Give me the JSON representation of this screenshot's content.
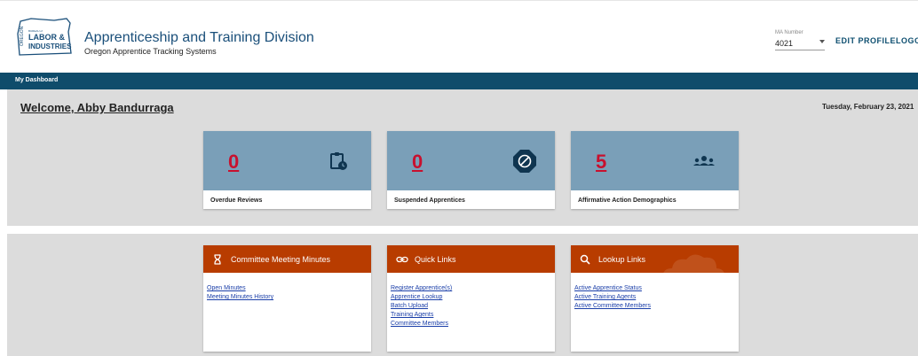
{
  "header": {
    "logo_text": "OREGON BUREAU of LABOR & INDUSTRIES",
    "title": "Apprenticeship and Training Division",
    "subtitle": "Oregon Apprentice Tracking Systems",
    "ma_number_label": "MA Number",
    "ma_number_value": "4021",
    "edit_profile": "EDIT PROFILE",
    "logout": "LOGOU"
  },
  "nav": {
    "items": [
      {
        "label": "My Dashboard"
      }
    ]
  },
  "welcome": {
    "text": "Welcome, Abby Bandurraga",
    "date": "Tuesday, February 23, 2021"
  },
  "stats": [
    {
      "value": "0",
      "label": "Overdue Reviews",
      "icon": "clipboard-clock-icon"
    },
    {
      "value": "0",
      "label": "Suspended Apprentices",
      "icon": "block-icon"
    },
    {
      "value": "5",
      "label": "Affirmative Action Demographics",
      "icon": "group-icon"
    }
  ],
  "panels": [
    {
      "title": "Committee Meeting Minutes",
      "icon": "hourglass-icon",
      "links": [
        "Open Minutes",
        "Meeting Minutes History"
      ]
    },
    {
      "title": "Quick Links",
      "icon": "link-icon",
      "links": [
        "Register Apprentice(s)",
        "Apprentice Lookup",
        "Batch Upload",
        "Training Agents",
        "Committee Members"
      ]
    },
    {
      "title": "Lookup Links",
      "icon": "search-icon",
      "links": [
        "Active Apprentice Status",
        "Active Training Agents",
        "Active Committee Members"
      ]
    }
  ],
  "colors": {
    "nav": "#0f4c6b",
    "stat_top": "#7a9fb8",
    "panel_head": "#b83c00",
    "stat_number": "#c8102e",
    "link": "#1a3ea8"
  }
}
